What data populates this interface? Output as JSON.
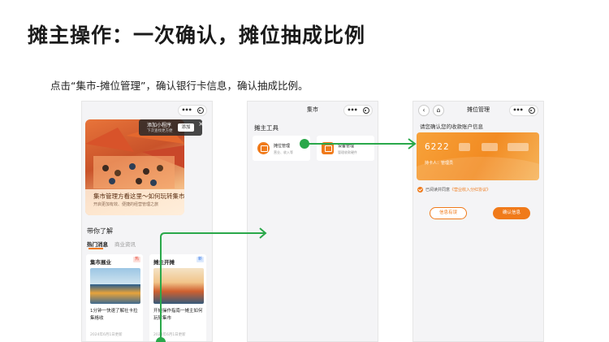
{
  "slide": {
    "title": "摊主操作：一次确认，摊位抽成比例",
    "subtitle": "点击“集市-摊位管理”，确认银行卡信息，确认抽成比例。"
  },
  "phone1": {
    "popup": {
      "title": "添加小程序",
      "subtitle": "下次查找更方便",
      "add_label": "添加",
      "close": "×"
    },
    "banner": {
      "title": "集市管理方看这里～如何玩转集市",
      "desc": "开启更加有效、便捷的经营管理之旅"
    },
    "section_title": "带你了解",
    "tabs": [
      {
        "label": "热门消息"
      },
      {
        "label": "商业资讯"
      }
    ],
    "cards": [
      {
        "head": "集市展业",
        "badge": "热",
        "text": "1分钟一快速了解社卡拉集格收",
        "date": "2024年6月1日更新"
      },
      {
        "head": "摊主开摊",
        "badge": "新",
        "text": "开摊操作指南一摊主如何玩转集市",
        "date": "2024年6月1日更新"
      }
    ]
  },
  "phone2": {
    "title": "集市",
    "tools_label": "摊主工具",
    "tools": [
      {
        "name": "摊位管理",
        "desc": "营业、收入等"
      },
      {
        "name": "设备管理",
        "desc": "管理收款硬件"
      }
    ]
  },
  "phone3": {
    "title": "摊位管理",
    "back_icon": "‹",
    "home_icon": "⌂",
    "confirm_label": "请您确认您的收款账户信息",
    "card_number_prefix": "6222",
    "card_holder": "持卡人：管理员",
    "agree_text": "已阅读并同意",
    "agree_link": "《营业收入分红协议》",
    "question_button": "信息有误",
    "confirm_button": "确认信息"
  },
  "colors": {
    "accent": "#f07a1a",
    "arrow": "#2aa84a"
  }
}
